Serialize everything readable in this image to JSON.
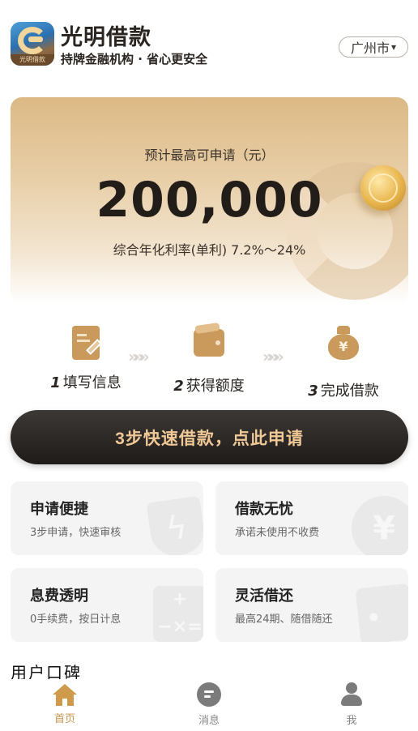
{
  "header": {
    "logo_caption": "光明借款",
    "title": "光明借款",
    "subtitle": "持牌金融机构 · 省心更安全",
    "city": "广州市",
    "city_arrow": "▾"
  },
  "hero": {
    "label": "预计最高可申请（元）",
    "amount": "200,000",
    "rate": "综合年化利率(单利) 7.2%～24%"
  },
  "steps": [
    {
      "num": "1",
      "label": "填写信息",
      "icon": "form-edit-icon"
    },
    {
      "num": "2",
      "label": "获得额度",
      "icon": "wallet-icon"
    },
    {
      "num": "3",
      "label": "完成借款",
      "icon": "money-bag-icon"
    }
  ],
  "step_separator": "»»»",
  "cta": {
    "label": "3步快速借款，点此申请"
  },
  "features": [
    {
      "title": "申请便捷",
      "desc": "3步申请，快速审核",
      "icon": "lightning-shield-icon"
    },
    {
      "title": "借款无忧",
      "desc": "承诺未使用不收费",
      "icon": "yen-circle-icon"
    },
    {
      "title": "息费透明",
      "desc": "0手续费，按日计息",
      "icon": "calculator-icon"
    },
    {
      "title": "灵活借还",
      "desc": "最高24期、随借随还",
      "icon": "wallet-icon"
    }
  ],
  "deco_glyphs": {
    "lightning": "ϟ",
    "yen": "¥",
    "calc": "+−×="
  },
  "reviews": {
    "title": "用户口碑"
  },
  "tabs": [
    {
      "label": "首页",
      "icon": "home-icon",
      "active": true
    },
    {
      "label": "消息",
      "icon": "message-icon",
      "active": false
    },
    {
      "label": "我",
      "icon": "profile-icon",
      "active": false
    }
  ],
  "colors": {
    "accent": "#c9954f",
    "cta_text": "#f0c996",
    "cta_bg": "#1e1b19",
    "hero_bg": "#dcb985",
    "card_bg": "#f4f4f5"
  }
}
